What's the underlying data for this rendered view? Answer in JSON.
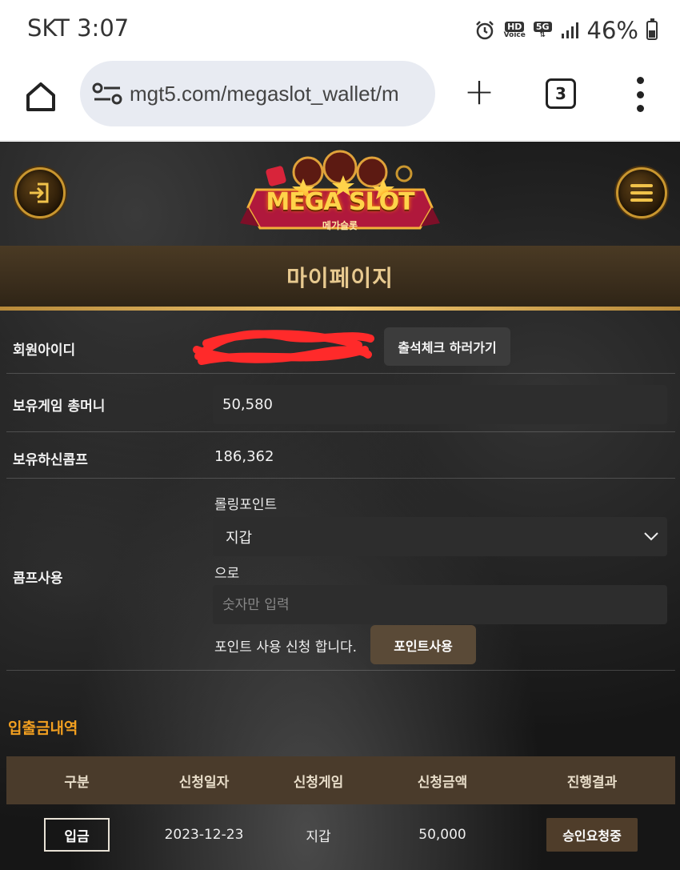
{
  "status_bar": {
    "carrier_time": "SKT 3:07",
    "hd_label": "HD",
    "voice_label": "Voice",
    "net_label": "5G",
    "battery_pct": "46%",
    "battery_level": 0.46,
    "icons": [
      "alarm-icon",
      "hd-voice-icon",
      "5g-icon",
      "signal-icon",
      "battery-icon"
    ]
  },
  "browser": {
    "url": "mgt5.com/megaslot_wallet/m",
    "tab_count": "3",
    "icons": [
      "home-icon",
      "site-settings-icon",
      "new-tab-icon",
      "tabs-icon",
      "more-icon"
    ]
  },
  "header": {
    "logo_text": "MEGA SLOT",
    "logo_sub": "메가슬롯",
    "icons": [
      "login-icon",
      "hamburger-icon"
    ]
  },
  "page": {
    "title": "마이페이지"
  },
  "member": {
    "id_label": "회원아이디",
    "attendance_button": "출석체크 하러가기",
    "money_label": "보유게임 총머니",
    "money_value": "50,580",
    "comp_label": "보유하신콤프",
    "comp_value": "186,362",
    "use_label": "콤프사용",
    "rolling_caption": "롤링포인트",
    "wallet_selected": "지갑",
    "ro_caption": "으로",
    "points_placeholder": "숫자만 입력",
    "apply_text": "포인트 사용 신청 합니다.",
    "use_points_button": "포인트사용"
  },
  "history": {
    "title": "입출금내역",
    "columns": [
      "구분",
      "신청일자",
      "신청게임",
      "신청금액",
      "진행결과"
    ],
    "rows": [
      {
        "type": "입금",
        "date": "2023-12-23",
        "game": "지갑",
        "amount": "50,000",
        "status": "승인요청중"
      }
    ]
  },
  "colors": {
    "accent_gold": "#e7c98f",
    "history_title": "#f3a020",
    "header_band": "#4a3a24",
    "table_header": "#4a3b2b"
  }
}
